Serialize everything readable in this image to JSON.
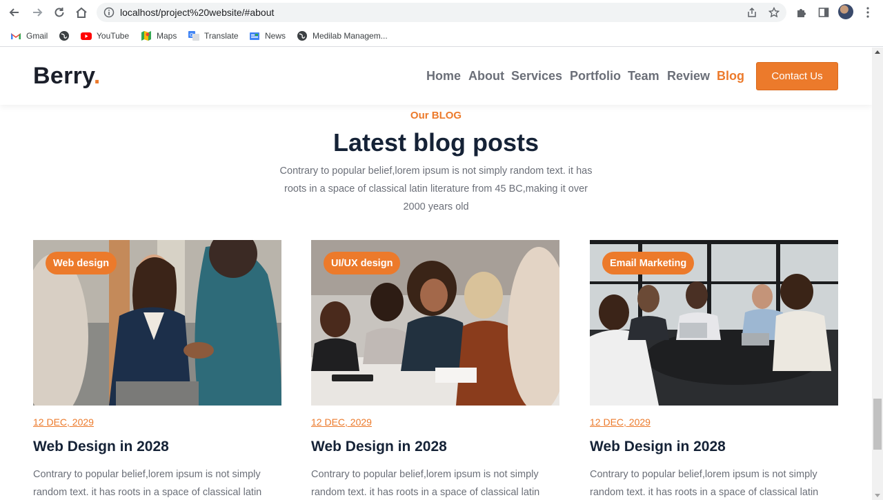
{
  "browser": {
    "url": "localhost/project%20website/#about",
    "bookmarks": [
      {
        "label": "Gmail",
        "icon": "gmail-icon"
      },
      {
        "label": "",
        "icon": "globe-icon"
      },
      {
        "label": "YouTube",
        "icon": "youtube-icon"
      },
      {
        "label": "Maps",
        "icon": "maps-icon"
      },
      {
        "label": "Translate",
        "icon": "translate-icon"
      },
      {
        "label": "News",
        "icon": "news-icon"
      },
      {
        "label": "Medilab Managem...",
        "icon": "globe-icon"
      }
    ]
  },
  "header": {
    "logo_text": "Berry",
    "logo_dot": ".",
    "nav": [
      "Home",
      "About",
      "Services",
      "Portfolio",
      "Team",
      "Review",
      "Blog"
    ],
    "active_nav": "Blog",
    "cta_label": "Contact Us"
  },
  "section": {
    "eyebrow": "Our BLOG",
    "title": "Latest blog posts",
    "description": "Contrary to popular belief,lorem ipsum is not simply random text. it has roots in a space of classical latin literature from 45 BC,making it over 2000 years old"
  },
  "posts": [
    {
      "tag": "Web design",
      "date": "12 DEC, 2029",
      "title": "Web Design in 2028",
      "excerpt": "Contrary to popular belief,lorem ipsum is not simply random text. it has roots in a space of classical latin"
    },
    {
      "tag": "UI/UX design",
      "date": "12 DEC, 2029",
      "title": "Web Design in 2028",
      "excerpt": "Contrary to popular belief,lorem ipsum is not simply random text. it has roots in a space of classical latin"
    },
    {
      "tag": "Email Marketing",
      "date": "12 DEC, 2029",
      "title": "Web Design in 2028",
      "excerpt": "Contrary to popular belief,lorem ipsum is not simply random text. it has roots in a space of classical latin"
    }
  ],
  "colors": {
    "accent": "#ec7a2b",
    "heading": "#152236",
    "body_text": "#6b6f78"
  }
}
